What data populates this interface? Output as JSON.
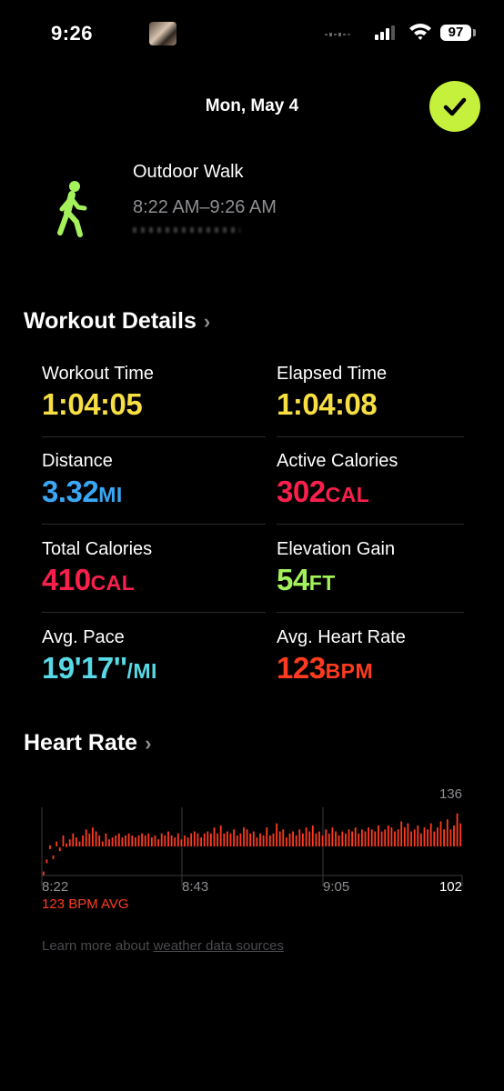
{
  "status_bar": {
    "time": "9:26",
    "battery": "97"
  },
  "header": {
    "date": "Mon, May 4"
  },
  "workout": {
    "title": "Outdoor Walk",
    "time_range": "8:22 AM–9:26 AM"
  },
  "details": {
    "heading": "Workout Details",
    "metrics": [
      {
        "label": "Workout Time",
        "value": "1:04:05",
        "unit": "",
        "color": "#f7df43"
      },
      {
        "label": "Elapsed Time",
        "value": "1:04:08",
        "unit": "",
        "color": "#f7df43"
      },
      {
        "label": "Distance",
        "value": "3.32",
        "unit": "MI",
        "color": "#3aa7f5"
      },
      {
        "label": "Active Calories",
        "value": "302",
        "unit": "CAL",
        "color": "#fb1f4c"
      },
      {
        "label": "Total Calories",
        "value": "410",
        "unit": "CAL",
        "color": "#fb1f4c"
      },
      {
        "label": "Elevation Gain",
        "value": "54",
        "unit": "FT",
        "color": "#a4f15c"
      },
      {
        "label": "Avg. Pace",
        "value": "19'17''",
        "unit": "/MI",
        "color": "#58d9e6"
      },
      {
        "label": "Avg. Heart Rate",
        "value": "123",
        "unit": "BPM",
        "color": "#ff3b1f"
      }
    ]
  },
  "heart_rate": {
    "heading": "Heart Rate",
    "max_label": "136",
    "min_label": "102",
    "x_labels": [
      "8:22",
      "8:43",
      "9:05"
    ],
    "avg_label": "123 BPM AVG",
    "bar_color": "#ff3b1f"
  },
  "chart_data": {
    "type": "bar",
    "ylim": [
      102,
      136
    ],
    "x_ticks": [
      "8:22",
      "8:43",
      "9:05"
    ],
    "values": [
      104,
      110,
      117,
      112,
      119,
      116,
      122,
      118,
      120,
      123,
      121,
      119,
      122,
      125,
      123,
      126,
      124,
      122,
      119,
      123,
      120,
      121,
      122,
      123,
      121,
      122,
      123,
      122,
      121,
      122,
      123,
      122,
      123,
      121,
      122,
      120,
      123,
      122,
      124,
      122,
      121,
      123,
      120,
      122,
      121,
      123,
      124,
      123,
      121,
      123,
      124,
      123,
      126,
      123,
      127,
      123,
      124,
      123,
      125,
      122,
      123,
      126,
      125,
      123,
      124,
      121,
      123,
      122,
      126,
      122,
      123,
      128,
      124,
      125,
      121,
      123,
      124,
      122,
      125,
      123,
      126,
      124,
      127,
      123,
      124,
      122,
      125,
      123,
      126,
      124,
      122,
      124,
      123,
      125,
      124,
      126,
      123,
      125,
      124,
      126,
      125,
      124,
      127,
      124,
      125,
      127,
      126,
      124,
      125,
      129,
      126,
      128,
      124,
      125,
      127,
      123,
      126,
      125,
      128,
      124,
      126,
      129,
      125,
      130,
      125,
      127,
      133,
      128
    ]
  },
  "footer": {
    "prefix": "Learn more about",
    "link": "weather data sources"
  }
}
